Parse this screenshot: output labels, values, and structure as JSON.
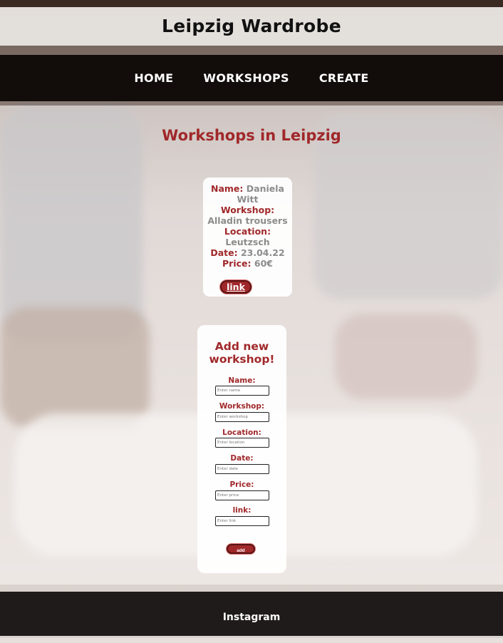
{
  "site": {
    "title": "Leipzig Wardrobe"
  },
  "nav": {
    "home": "HOME",
    "workshops": "WORKSHOPS",
    "create": "CREATE"
  },
  "page": {
    "heading": "Workshops in Leipzig"
  },
  "workshop_card": {
    "name_label": "Name:",
    "name_value": "Daniela Witt",
    "workshop_label": "Workshop:",
    "workshop_value": "Alladin trousers",
    "location_label": "Location:",
    "location_value": "Leutzsch",
    "date_label": "Date:",
    "date_value": "23.04.22",
    "price_label": "Price:",
    "price_value": "60€",
    "link_label": "link"
  },
  "add_form": {
    "title": "Add new workshop!",
    "fields": {
      "name": {
        "label": "Name:",
        "placeholder": "Enter name"
      },
      "workshop": {
        "label": "Workshop:",
        "placeholder": "Enter workshop"
      },
      "location": {
        "label": "Location:",
        "placeholder": "Enter location"
      },
      "date": {
        "label": "Date:",
        "placeholder": "Enter date"
      },
      "price": {
        "label": "Price:",
        "placeholder": "Enter price"
      },
      "link": {
        "label": "link:",
        "placeholder": "Enter link"
      }
    },
    "submit_label": "add"
  },
  "footer": {
    "instagram": "Instagram"
  },
  "colors": {
    "accent": "#a0282a",
    "nav_bg": "#120d0b",
    "footer_bg": "#1f1b1a"
  }
}
